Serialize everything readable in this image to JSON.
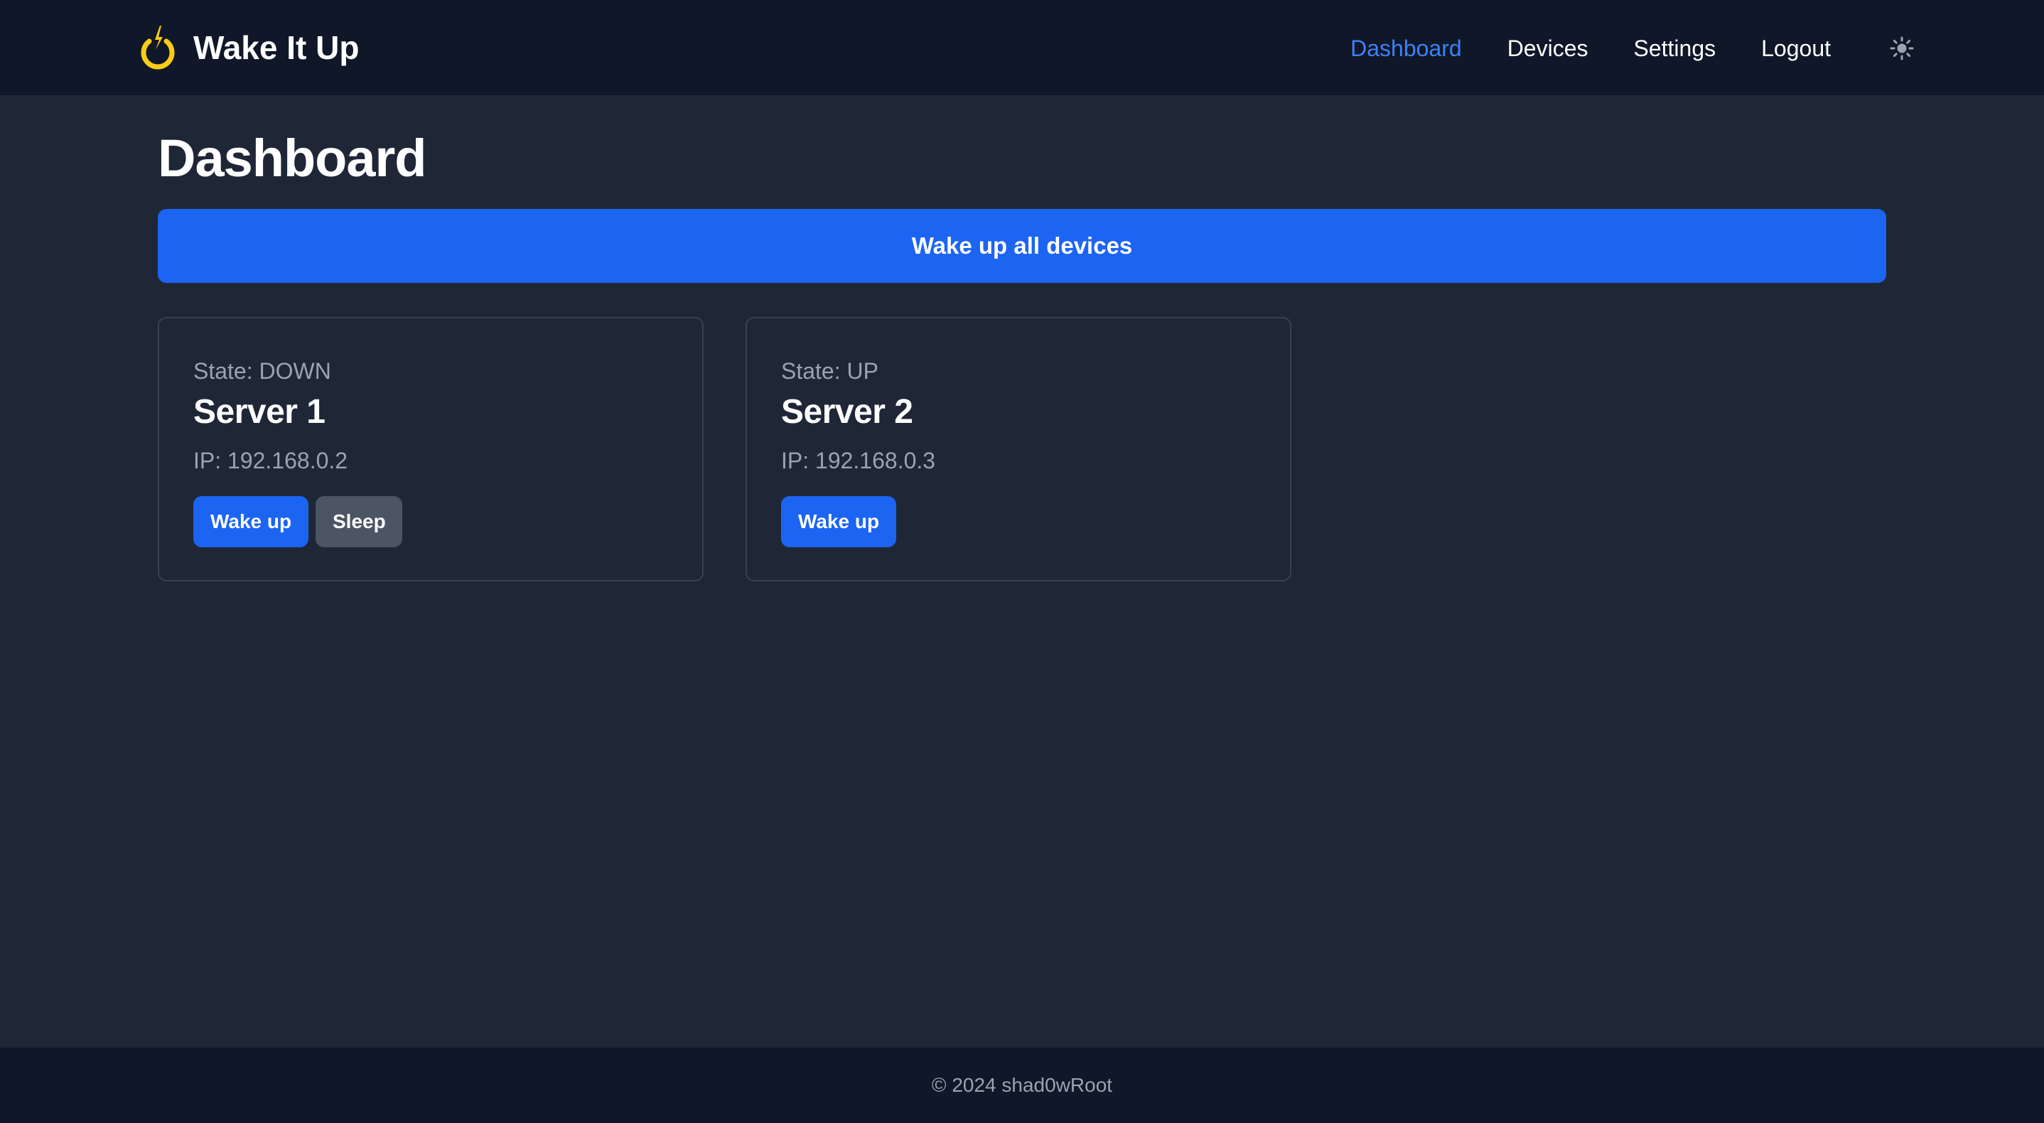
{
  "colors": {
    "navbar_bg": "#0f1729",
    "page_bg": "#1f2737",
    "accent": "#1c64f2",
    "active_link": "#3b82f6",
    "logo": "#facc15",
    "muted_text": "#9ca3af",
    "secondary_button": "#4b5563"
  },
  "header": {
    "brand_icon": "power-icon",
    "brand_title": "Wake It Up",
    "nav": [
      {
        "label": "Dashboard",
        "active": true
      },
      {
        "label": "Devices",
        "active": false
      },
      {
        "label": "Settings",
        "active": false
      },
      {
        "label": "Logout",
        "active": false
      }
    ],
    "theme_toggle_icon": "sun-icon"
  },
  "main": {
    "title": "Dashboard",
    "wake_all_label": "Wake up all devices",
    "devices": [
      {
        "state": "State: DOWN",
        "name": "Server 1",
        "ip": "IP: 192.168.0.2",
        "wake_label": "Wake up",
        "sleep_label": "Sleep"
      },
      {
        "state": "State: UP",
        "name": "Server 2",
        "ip": "IP: 192.168.0.3",
        "wake_label": "Wake up"
      }
    ]
  },
  "footer": {
    "text": "© 2024 shad0wRoot"
  }
}
